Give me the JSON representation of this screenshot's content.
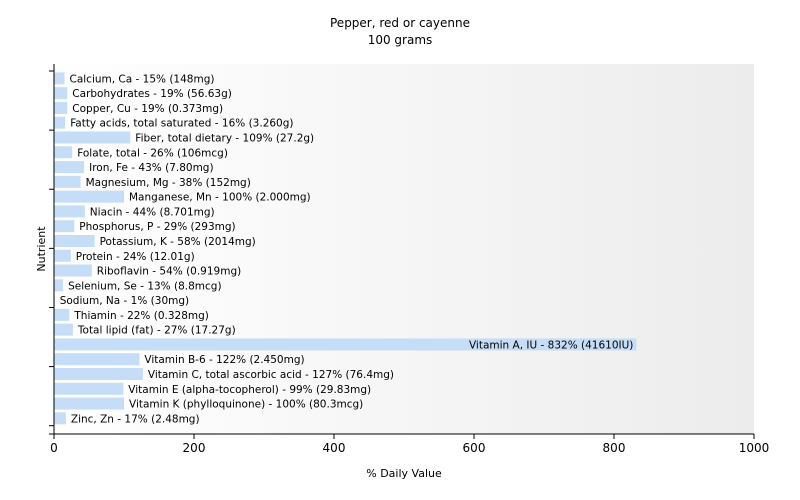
{
  "chart_data": {
    "type": "bar",
    "orientation": "horizontal",
    "title": "Pepper, red or cayenne",
    "subtitle": "100 grams",
    "xlabel": "% Daily Value",
    "ylabel": "Nutrient",
    "xlim": [
      0,
      1000
    ],
    "xticks": [
      "0",
      "200",
      "400",
      "600",
      "800",
      "1000"
    ],
    "grid": false,
    "bar_color": "#c5ddf7",
    "bars": [
      {
        "value": 15,
        "label": "Calcium, Ca - 15% (148mg)"
      },
      {
        "value": 19,
        "label": "Carbohydrates - 19% (56.63g)"
      },
      {
        "value": 19,
        "label": "Copper, Cu - 19% (0.373mg)"
      },
      {
        "value": 16,
        "label": "Fatty acids, total saturated - 16% (3.260g)"
      },
      {
        "value": 109,
        "label": "Fiber, total dietary - 109% (27.2g)"
      },
      {
        "value": 26,
        "label": "Folate, total - 26% (106mcg)"
      },
      {
        "value": 43,
        "label": "Iron, Fe - 43% (7.80mg)"
      },
      {
        "value": 38,
        "label": "Magnesium, Mg - 38% (152mg)"
      },
      {
        "value": 100,
        "label": "Manganese, Mn - 100% (2.000mg)"
      },
      {
        "value": 44,
        "label": "Niacin - 44% (8.701mg)"
      },
      {
        "value": 29,
        "label": "Phosphorus, P - 29% (293mg)"
      },
      {
        "value": 58,
        "label": "Potassium, K - 58% (2014mg)"
      },
      {
        "value": 24,
        "label": "Protein - 24% (12.01g)"
      },
      {
        "value": 54,
        "label": "Riboflavin - 54% (0.919mg)"
      },
      {
        "value": 13,
        "label": "Selenium, Se - 13% (8.8mcg)"
      },
      {
        "value": 1,
        "label": "Sodium, Na - 1% (30mg)"
      },
      {
        "value": 22,
        "label": "Thiamin - 22% (0.328mg)"
      },
      {
        "value": 27,
        "label": "Total lipid (fat) - 27% (17.27g)"
      },
      {
        "value": 832,
        "label": "Vitamin A, IU - 832% (41610IU)"
      },
      {
        "value": 122,
        "label": "Vitamin B-6 - 122% (2.450mg)"
      },
      {
        "value": 127,
        "label": "Vitamin C, total ascorbic acid - 127% (76.4mg)"
      },
      {
        "value": 99,
        "label": "Vitamin E (alpha-tocopherol) - 99% (29.83mg)"
      },
      {
        "value": 100,
        "label": "Vitamin K (phylloquinone) - 100% (80.3mcg)"
      },
      {
        "value": 17,
        "label": "Zinc, Zn - 17% (2.48mg)"
      }
    ]
  }
}
